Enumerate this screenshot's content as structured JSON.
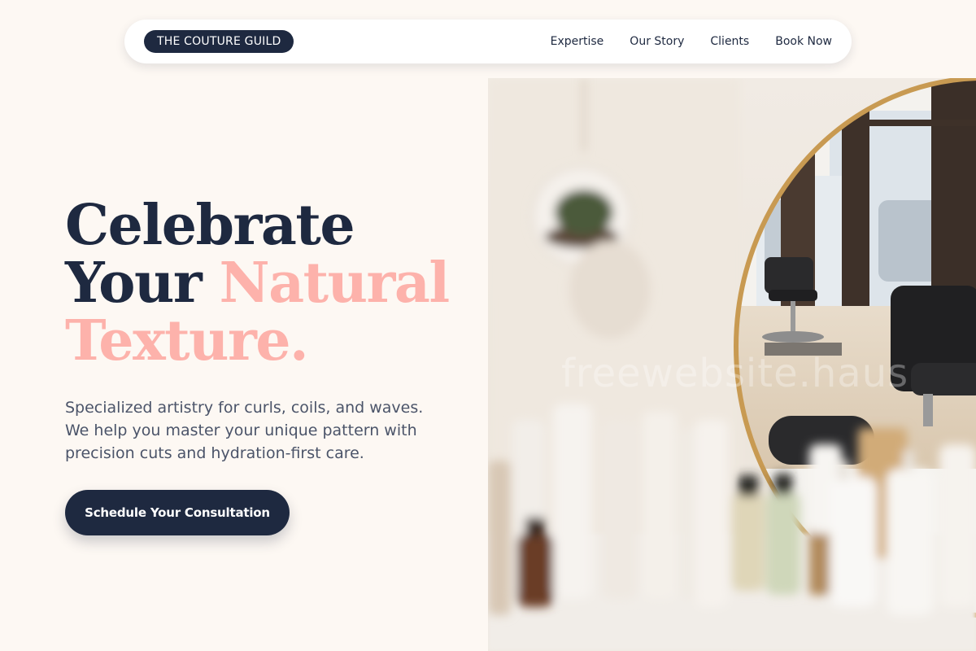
{
  "nav": {
    "brand": "THE COUTURE GUILD",
    "links": [
      "Expertise",
      "Our Story",
      "Clients",
      "Book Now"
    ]
  },
  "hero": {
    "headline": {
      "line1": "Celebrate",
      "line2_plain": "Your ",
      "line2_accent": "Natural",
      "line3_accent": "Texture."
    },
    "lede": "Specialized artistry for curls, coils, and waves. We help you master your unique pattern with precision cuts and hydration-first care.",
    "cta": "Schedule Your Consultation"
  },
  "photo": {
    "subject": "salon-interior-photo",
    "watermark": "freewebsite.haus"
  },
  "colors": {
    "navy": "#1e2940",
    "accent_pink": "#fdb2ab",
    "background": "#fdf8f3",
    "body_text": "#4b5469"
  }
}
